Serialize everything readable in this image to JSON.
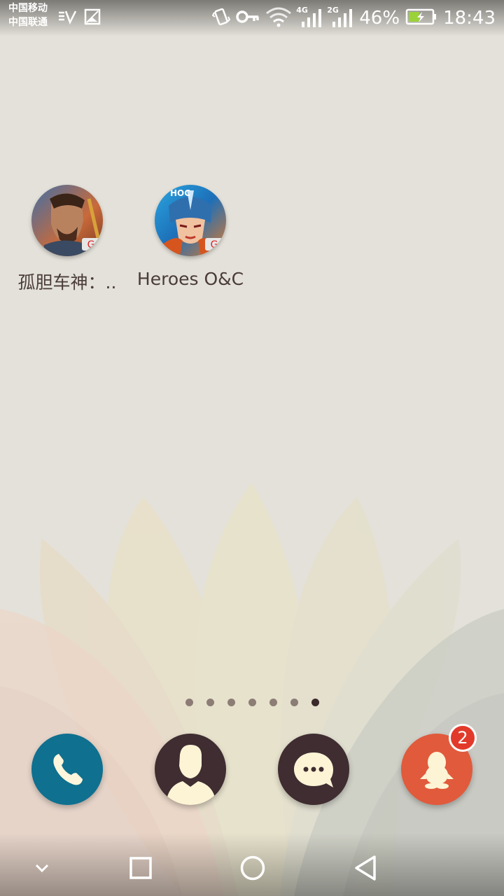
{
  "status_bar": {
    "carrier_1": "中国移动",
    "carrier_2": "中国联通",
    "signal_1_label": "4G",
    "signal_2_label": "2G",
    "battery_percent": "46%",
    "battery_level": 0.46,
    "time": "18:43",
    "icons": [
      "v-icon",
      "image-icon",
      "vibrate-icon",
      "key-icon",
      "wifi-icon",
      "signal-icon",
      "signal-icon",
      "battery-charging-icon"
    ]
  },
  "apps": [
    {
      "label": "孤胆车神：..",
      "icon": "game-gangster-icon"
    },
    {
      "label": "Heroes O&C",
      "icon": "game-heroes-icon"
    }
  ],
  "page_indicator": {
    "count": 7,
    "active_index": 6
  },
  "dock": {
    "phone": {
      "icon": "phone-icon",
      "color": "#0f7090"
    },
    "contacts": {
      "icon": "contacts-icon",
      "color": "#3f2d31"
    },
    "messages": {
      "icon": "messages-icon",
      "color": "#3f2d31"
    },
    "qq": {
      "icon": "qq-icon",
      "color": "#e15a3c",
      "badge": "2"
    }
  },
  "nav": [
    "collapse-icon",
    "recent-apps-icon",
    "home-icon",
    "back-icon"
  ]
}
